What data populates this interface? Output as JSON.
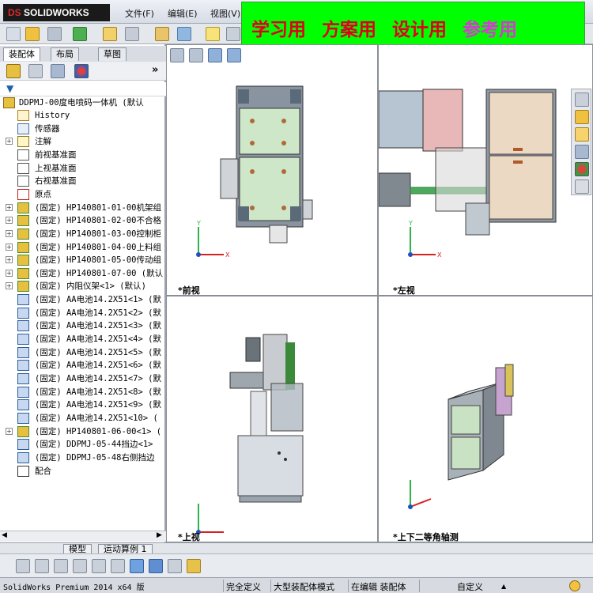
{
  "app": {
    "logo_prefix": "DS",
    "logo_text": "SOLIDWORKS"
  },
  "menu": [
    "文件(F)",
    "编辑(E)",
    "视图(V)"
  ],
  "banner": [
    "学习用",
    "方案用",
    "设计用",
    "参考用"
  ],
  "tabs": [
    "装配体",
    "布局",
    "草图"
  ],
  "tree": {
    "root": "DDPMJ-00度电喷码一体机 (默认",
    "items": [
      {
        "label": "History",
        "icon": "history-icon",
        "expand": false
      },
      {
        "label": "传感器",
        "icon": "sensor-icon",
        "expand": false
      },
      {
        "label": "注解",
        "icon": "annotation-icon",
        "expand": true
      },
      {
        "label": "前视基准面",
        "icon": "plane-icon",
        "expand": false
      },
      {
        "label": "上视基准面",
        "icon": "plane-icon",
        "expand": false
      },
      {
        "label": "右视基准面",
        "icon": "plane-icon",
        "expand": false
      },
      {
        "label": "原点",
        "icon": "origin-icon",
        "expand": false
      },
      {
        "label": "(固定) HP140801-01-00机架组",
        "icon": "assembly-icon",
        "expand": true
      },
      {
        "label": "(固定) HP140801-02-00不合格",
        "icon": "assembly-icon",
        "expand": true
      },
      {
        "label": "(固定) HP140801-03-00控制柜",
        "icon": "assembly-icon",
        "expand": true
      },
      {
        "label": "(固定) HP140801-04-00上料组",
        "icon": "assembly-icon",
        "expand": true
      },
      {
        "label": "(固定) HP140801-05-00传动组",
        "icon": "assembly-icon",
        "expand": true
      },
      {
        "label": "(固定) HP140801-07-00 (默认",
        "icon": "assembly-icon",
        "expand": true
      },
      {
        "label": "(固定) 内阻仪架<1> (默认)",
        "icon": "assembly-icon",
        "expand": true
      },
      {
        "label": "(固定) AA电池14.2X51<1> (默",
        "icon": "part-icon",
        "expand": false
      },
      {
        "label": "(固定) AA电池14.2X51<2> (默",
        "icon": "part-icon",
        "expand": false
      },
      {
        "label": "(固定) AA电池14.2X51<3> (默",
        "icon": "part-icon",
        "expand": false
      },
      {
        "label": "(固定) AA电池14.2X51<4> (默",
        "icon": "part-icon",
        "expand": false
      },
      {
        "label": "(固定) AA电池14.2X51<5> (默",
        "icon": "part-icon",
        "expand": false
      },
      {
        "label": "(固定) AA电池14.2X51<6> (默",
        "icon": "part-icon",
        "expand": false
      },
      {
        "label": "(固定) AA电池14.2X51<7> (默",
        "icon": "part-icon",
        "expand": false
      },
      {
        "label": "(固定) AA电池14.2X51<8> (默",
        "icon": "part-icon",
        "expand": false
      },
      {
        "label": "(固定) AA电池14.2X51<9> (默",
        "icon": "part-icon",
        "expand": false
      },
      {
        "label": "(固定) AA电池14.2X51<10> (",
        "icon": "part-icon",
        "expand": false
      },
      {
        "label": "(固定) HP140801-06-00<1> (",
        "icon": "assembly-icon",
        "expand": true
      },
      {
        "label": "(固定) DDPMJ-05-44挡边<1>",
        "icon": "part-icon",
        "expand": false
      },
      {
        "label": "(固定) DDPMJ-05-48右侧挡边",
        "icon": "part-icon",
        "expand": false
      },
      {
        "label": "配合",
        "icon": "mates-icon",
        "expand": false
      }
    ]
  },
  "viewports": {
    "front": "*前视",
    "left": "*左视",
    "top": "*上视",
    "iso": "*上下二等角轴测"
  },
  "bottom_tabs": [
    "模型",
    "运动算例 1"
  ],
  "status": {
    "version": "SolidWorks Premium 2014 x64 版",
    "s1": "完全定义",
    "s2": "大型装配体模式",
    "s3": "在编辑 装配体",
    "s4": "自定义"
  }
}
